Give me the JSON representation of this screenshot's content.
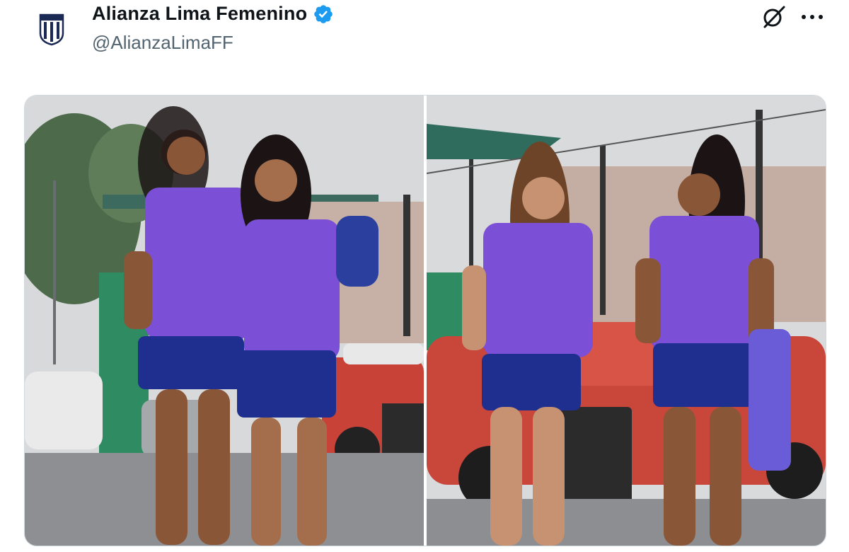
{
  "tweet": {
    "author": {
      "display_name": "Alianza Lima Femenino",
      "handle": "@AlianzaLimaFF",
      "verified": true,
      "avatar_icon": "alianza-lima-crest-icon"
    },
    "actions": {
      "grok_icon": "grok-icon",
      "more_icon": "more-options-icon"
    },
    "media": {
      "count": 2,
      "photos": [
        {
          "icon": "photo-1"
        },
        {
          "icon": "photo-2"
        }
      ]
    }
  },
  "colors": {
    "text_primary": "#0f1419",
    "text_secondary": "#536471",
    "verified_blue": "#1d9bf0",
    "jersey_purple": "#7b4fd6",
    "shorts_navy": "#1f2f8f",
    "border": "#cfd9de"
  }
}
